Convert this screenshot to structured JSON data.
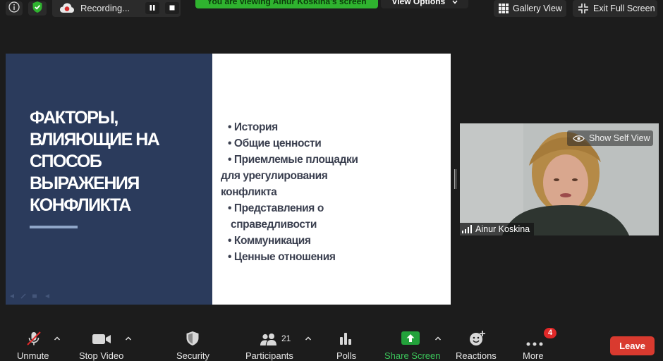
{
  "topbar": {
    "recording_label": "Recording...",
    "banner_text": "You are viewing Ainur Koskina's screen",
    "view_options_label": "View Options",
    "gallery_view_label": "Gallery View",
    "exit_full_screen_label": "Exit Full Screen"
  },
  "slide": {
    "title_lines": [
      "ФАКТОРЫ,",
      "ВЛИЯЮЩИЕ НА",
      "СПОСОБ",
      "ВЫРАЖЕНИЯ",
      "КОНФЛИКТА"
    ],
    "bullets": [
      "• История",
      "• Общие ценности",
      "• Приемлемые площадки",
      "для  урегулирования",
      "конфликта",
      "• Представления о",
      "  справедливости",
      "• Коммуникация",
      "• Ценные отношения"
    ]
  },
  "video": {
    "show_self_view_label": "Show Self View",
    "participant_name": "Ainur Koskina"
  },
  "toolbar": {
    "unmute_label": "Unmute",
    "stop_video_label": "Stop Video",
    "security_label": "Security",
    "participants_label": "Participants",
    "participants_count": "21",
    "polls_label": "Polls",
    "share_screen_label": "Share Screen",
    "reactions_label": "Reactions",
    "more_label": "More",
    "more_badge": "4",
    "leave_label": "Leave"
  },
  "colors": {
    "background": "#1c1c1c",
    "banner_green": "#2fb32f",
    "slide_navy": "#2b3b5c",
    "share_green": "#23a23b",
    "leave_red": "#d93a2f",
    "mute_red": "#e02828"
  }
}
